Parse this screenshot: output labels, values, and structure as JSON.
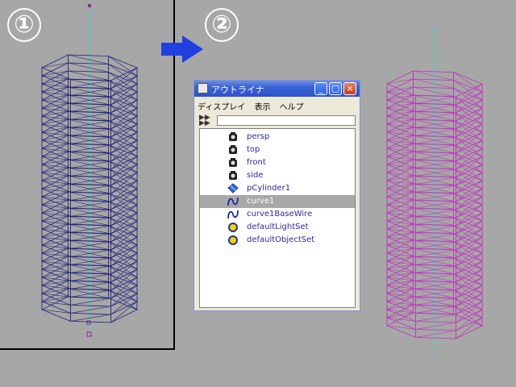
{
  "steps": {
    "one": "①",
    "two": "②"
  },
  "outliner": {
    "title": "アウトライナ",
    "menu": [
      "ディスプレイ",
      "表示",
      "ヘルプ"
    ],
    "buttons": {
      "minimize": "_",
      "maximize": "□",
      "close": "×"
    },
    "filter_value": "",
    "items": [
      {
        "label": "persp",
        "icon": "camera-icon"
      },
      {
        "label": "top",
        "icon": "camera-icon"
      },
      {
        "label": "front",
        "icon": "camera-icon"
      },
      {
        "label": "side",
        "icon": "camera-icon"
      },
      {
        "label": "pCylinder1",
        "icon": "mesh-icon"
      },
      {
        "label": "curve1",
        "icon": "curve-icon",
        "selected": true
      },
      {
        "label": "curve1BaseWire",
        "icon": "curve-icon"
      },
      {
        "label": "defaultLightSet",
        "icon": "set-icon"
      },
      {
        "label": "defaultObjectSet",
        "icon": "set-icon"
      }
    ]
  },
  "colors": {
    "viewport_bg": "#a7a7a7",
    "wire_left": "#1f1f7a",
    "wire_right": "#c030c0",
    "pivot_line": "#3fd0c8",
    "arrow": "#2040e0"
  }
}
